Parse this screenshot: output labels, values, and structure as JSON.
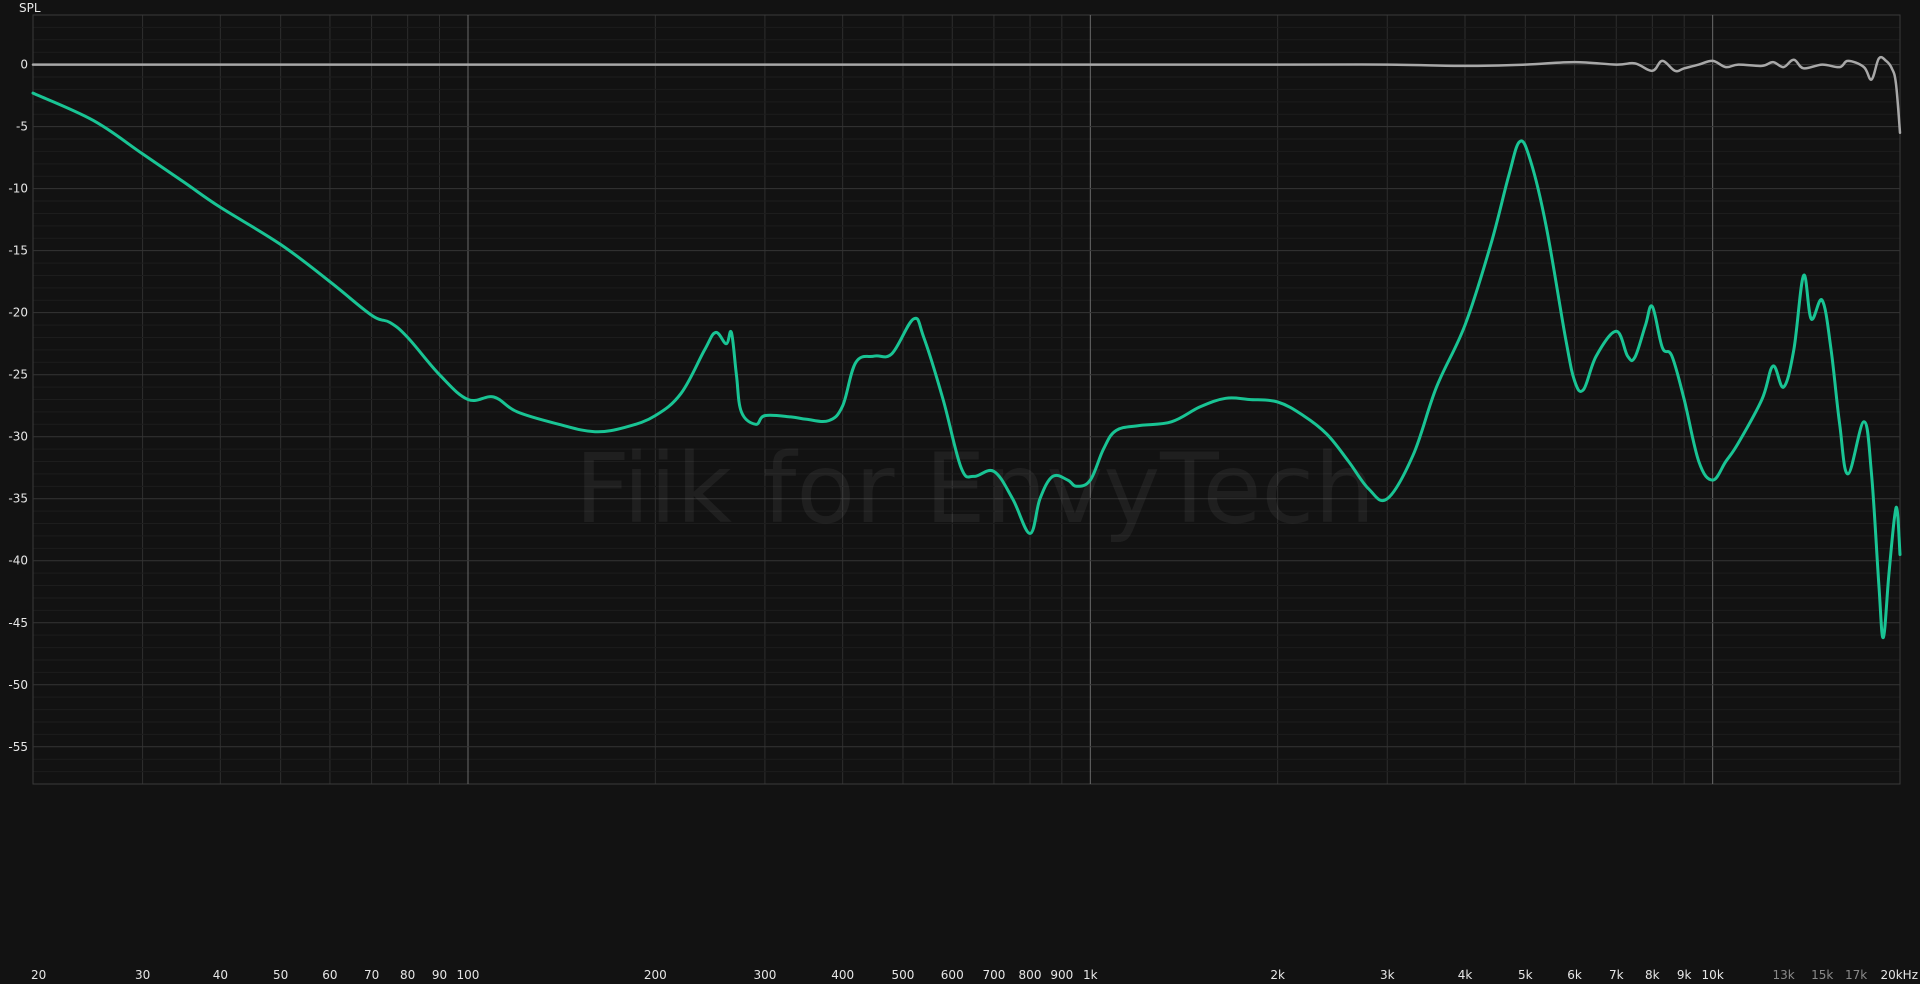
{
  "chart_data": {
    "type": "line",
    "ylabel": "SPL",
    "watermark": "Fiik for EnvyTech",
    "x_scale": "log",
    "xlim": [
      20,
      20000
    ],
    "ylim": [
      -58,
      4
    ],
    "grid": true,
    "x_ticks": [
      {
        "value": 20,
        "label": "20"
      },
      {
        "value": 30,
        "label": "30"
      },
      {
        "value": 40,
        "label": "40"
      },
      {
        "value": 50,
        "label": "50"
      },
      {
        "value": 60,
        "label": "60"
      },
      {
        "value": 70,
        "label": "70"
      },
      {
        "value": 80,
        "label": "80"
      },
      {
        "value": 90,
        "label": "90"
      },
      {
        "value": 100,
        "label": "100"
      },
      {
        "value": 200,
        "label": "200"
      },
      {
        "value": 300,
        "label": "300"
      },
      {
        "value": 400,
        "label": "400"
      },
      {
        "value": 500,
        "label": "500"
      },
      {
        "value": 600,
        "label": "600"
      },
      {
        "value": 700,
        "label": "700"
      },
      {
        "value": 800,
        "label": "800"
      },
      {
        "value": 900,
        "label": "900"
      },
      {
        "value": 1000,
        "label": "1k"
      },
      {
        "value": 2000,
        "label": "2k"
      },
      {
        "value": 3000,
        "label": "3k"
      },
      {
        "value": 4000,
        "label": "4k"
      },
      {
        "value": 5000,
        "label": "5k"
      },
      {
        "value": 6000,
        "label": "6k"
      },
      {
        "value": 7000,
        "label": "7k"
      },
      {
        "value": 8000,
        "label": "8k"
      },
      {
        "value": 9000,
        "label": "9k"
      },
      {
        "value": 10000,
        "label": "10k"
      },
      {
        "value": 13000,
        "label": "13k",
        "dim": true
      },
      {
        "value": 15000,
        "label": "15k",
        "dim": true
      },
      {
        "value": 17000,
        "label": "17k",
        "dim": true
      },
      {
        "value": 20000,
        "label": "20kHz"
      }
    ],
    "y_ticks": [
      0,
      -5,
      -10,
      -15,
      -20,
      -25,
      -30,
      -35,
      -40,
      -45,
      -50,
      -55
    ],
    "series": [
      {
        "color": "#a8a8a8",
        "points": [
          [
            20,
            0.0
          ],
          [
            100,
            0.0
          ],
          [
            300,
            0.0
          ],
          [
            1000,
            0.0
          ],
          [
            2000,
            0.0
          ],
          [
            3000,
            0.0
          ],
          [
            4000,
            -0.1
          ],
          [
            5000,
            0.0
          ],
          [
            6000,
            0.2
          ],
          [
            7000,
            0.0
          ],
          [
            7500,
            0.1
          ],
          [
            8000,
            -0.5
          ],
          [
            8300,
            0.3
          ],
          [
            8700,
            -0.5
          ],
          [
            9000,
            -0.3
          ],
          [
            9500,
            0.0
          ],
          [
            10000,
            0.3
          ],
          [
            10500,
            -0.2
          ],
          [
            11000,
            0.0
          ],
          [
            12000,
            -0.1
          ],
          [
            12500,
            0.2
          ],
          [
            13000,
            -0.2
          ],
          [
            13500,
            0.4
          ],
          [
            14000,
            -0.3
          ],
          [
            15000,
            0.0
          ],
          [
            16000,
            -0.2
          ],
          [
            16500,
            0.3
          ],
          [
            17500,
            -0.2
          ],
          [
            18000,
            -1.2
          ],
          [
            18500,
            0.5
          ],
          [
            19000,
            0.3
          ],
          [
            19400,
            -0.3
          ],
          [
            19700,
            -1.5
          ],
          [
            20000,
            -5.5
          ]
        ]
      },
      {
        "color": "#19c494",
        "points": [
          [
            20,
            -2.3
          ],
          [
            25,
            -4.5
          ],
          [
            30,
            -7.2
          ],
          [
            35,
            -9.5
          ],
          [
            40,
            -11.5
          ],
          [
            50,
            -14.5
          ],
          [
            60,
            -17.5
          ],
          [
            70,
            -20.2
          ],
          [
            75,
            -20.8
          ],
          [
            80,
            -22.0
          ],
          [
            90,
            -25.0
          ],
          [
            100,
            -27.0
          ],
          [
            110,
            -26.8
          ],
          [
            120,
            -28.0
          ],
          [
            140,
            -29.0
          ],
          [
            160,
            -29.6
          ],
          [
            180,
            -29.2
          ],
          [
            200,
            -28.3
          ],
          [
            220,
            -26.5
          ],
          [
            240,
            -23.0
          ],
          [
            250,
            -21.6
          ],
          [
            260,
            -22.5
          ],
          [
            265,
            -21.6
          ],
          [
            270,
            -25.0
          ],
          [
            275,
            -28.0
          ],
          [
            290,
            -29.0
          ],
          [
            300,
            -28.3
          ],
          [
            330,
            -28.4
          ],
          [
            350,
            -28.6
          ],
          [
            380,
            -28.7
          ],
          [
            400,
            -27.5
          ],
          [
            420,
            -24.0
          ],
          [
            450,
            -23.5
          ],
          [
            480,
            -23.3
          ],
          [
            520,
            -20.5
          ],
          [
            540,
            -22.0
          ],
          [
            580,
            -27.0
          ],
          [
            620,
            -32.5
          ],
          [
            650,
            -33.2
          ],
          [
            700,
            -32.8
          ],
          [
            750,
            -35.0
          ],
          [
            800,
            -37.8
          ],
          [
            830,
            -35.0
          ],
          [
            870,
            -33.2
          ],
          [
            920,
            -33.5
          ],
          [
            950,
            -34.0
          ],
          [
            1000,
            -33.5
          ],
          [
            1050,
            -31.0
          ],
          [
            1100,
            -29.5
          ],
          [
            1200,
            -29.1
          ],
          [
            1350,
            -28.8
          ],
          [
            1500,
            -27.6
          ],
          [
            1650,
            -26.9
          ],
          [
            1800,
            -27.0
          ],
          [
            2000,
            -27.2
          ],
          [
            2200,
            -28.3
          ],
          [
            2400,
            -29.8
          ],
          [
            2600,
            -32.0
          ],
          [
            2800,
            -34.2
          ],
          [
            3000,
            -35.0
          ],
          [
            3300,
            -31.5
          ],
          [
            3600,
            -26.0
          ],
          [
            4000,
            -21.0
          ],
          [
            4400,
            -14.5
          ],
          [
            4700,
            -9.0
          ],
          [
            4900,
            -6.2
          ],
          [
            5100,
            -7.8
          ],
          [
            5400,
            -13.0
          ],
          [
            5800,
            -22.0
          ],
          [
            6000,
            -25.5
          ],
          [
            6200,
            -26.2
          ],
          [
            6500,
            -23.5
          ],
          [
            7000,
            -21.5
          ],
          [
            7300,
            -23.5
          ],
          [
            7500,
            -23.6
          ],
          [
            7800,
            -21.0
          ],
          [
            8000,
            -19.5
          ],
          [
            8300,
            -22.8
          ],
          [
            8600,
            -23.5
          ],
          [
            9000,
            -27.0
          ],
          [
            9500,
            -32.0
          ],
          [
            10000,
            -33.5
          ],
          [
            10500,
            -32.0
          ],
          [
            11000,
            -30.5
          ],
          [
            12000,
            -27.0
          ],
          [
            12500,
            -24.3
          ],
          [
            13000,
            -26.0
          ],
          [
            13500,
            -23.0
          ],
          [
            14000,
            -17.0
          ],
          [
            14400,
            -20.5
          ],
          [
            15000,
            -19.0
          ],
          [
            15500,
            -23.0
          ],
          [
            16000,
            -29.0
          ],
          [
            16500,
            -33.0
          ],
          [
            17500,
            -28.8
          ],
          [
            18000,
            -33.0
          ],
          [
            18500,
            -42.0
          ],
          [
            18800,
            -46.2
          ],
          [
            19200,
            -41.0
          ],
          [
            19600,
            -36.5
          ],
          [
            19800,
            -36.0
          ],
          [
            20000,
            -39.5
          ]
        ]
      }
    ]
  }
}
